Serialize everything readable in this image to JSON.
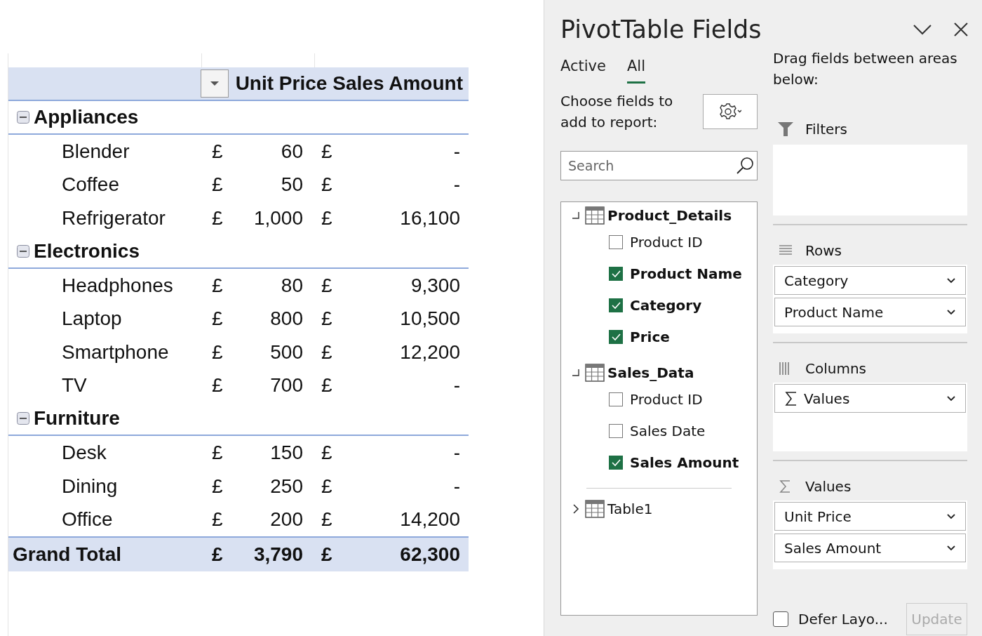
{
  "pivot": {
    "header": {
      "columns": [
        "Unit Price",
        "Sales Amount"
      ]
    },
    "groups": [
      {
        "name": "Appliances",
        "expanded": true,
        "items": [
          {
            "name": "Blender",
            "unit_currency": "£",
            "unit_price": "60",
            "sales_currency": "£",
            "sales_amount": "-"
          },
          {
            "name": "Coffee",
            "unit_currency": "£",
            "unit_price": "50",
            "sales_currency": "£",
            "sales_amount": "-"
          },
          {
            "name": "Refrigerator",
            "unit_currency": "£",
            "unit_price": "1,000",
            "sales_currency": "£",
            "sales_amount": "16,100"
          }
        ]
      },
      {
        "name": "Electronics",
        "expanded": true,
        "items": [
          {
            "name": "Headphones",
            "unit_currency": "£",
            "unit_price": "80",
            "sales_currency": "£",
            "sales_amount": "9,300"
          },
          {
            "name": "Laptop",
            "unit_currency": "£",
            "unit_price": "800",
            "sales_currency": "£",
            "sales_amount": "10,500"
          },
          {
            "name": "Smartphone",
            "unit_currency": "£",
            "unit_price": "500",
            "sales_currency": "£",
            "sales_amount": "12,200"
          },
          {
            "name": "TV",
            "unit_currency": "£",
            "unit_price": "700",
            "sales_currency": "£",
            "sales_amount": "-"
          }
        ]
      },
      {
        "name": "Furniture",
        "expanded": true,
        "items": [
          {
            "name": "Desk",
            "unit_currency": "£",
            "unit_price": "150",
            "sales_currency": "£",
            "sales_amount": "-"
          },
          {
            "name": "Dining",
            "unit_currency": "£",
            "unit_price": "250",
            "sales_currency": "£",
            "sales_amount": "-"
          },
          {
            "name": "Office",
            "unit_currency": "£",
            "unit_price": "200",
            "sales_currency": "£",
            "sales_amount": "14,200"
          }
        ]
      }
    ],
    "grand_total": {
      "label": "Grand Total",
      "unit_currency": "£",
      "unit_price": "3,790",
      "sales_currency": "£",
      "sales_amount": "62,300"
    }
  },
  "pane": {
    "title": "PivotTable Fields",
    "tabs": [
      {
        "label": "Active",
        "selected": false
      },
      {
        "label": "All",
        "selected": true
      }
    ],
    "choose_label": "Choose fields to add to report:",
    "search": {
      "placeholder": "Search"
    },
    "tables": [
      {
        "name": "Product_Details",
        "expanded": true,
        "fields": [
          {
            "name": "Product ID",
            "checked": false
          },
          {
            "name": "Product Name",
            "checked": true
          },
          {
            "name": "Category",
            "checked": true
          },
          {
            "name": "Price",
            "checked": true
          }
        ]
      },
      {
        "name": "Sales_Data",
        "expanded": true,
        "fields": [
          {
            "name": "Product ID",
            "checked": false
          },
          {
            "name": "Sales Date",
            "checked": false
          },
          {
            "name": "Sales Amount",
            "checked": true
          }
        ]
      },
      {
        "name": "Table1",
        "expanded": false
      }
    ],
    "areas_hint": "Drag fields between areas below:",
    "areas": [
      {
        "kind": "filters",
        "label": "Filters"
      },
      {
        "kind": "rows",
        "label": "Rows",
        "items": [
          {
            "label": "Category",
            "kind": "field"
          },
          {
            "label": "Product Name",
            "kind": "field"
          }
        ]
      },
      {
        "kind": "columns",
        "label": "Columns",
        "items": [
          {
            "label": "Values",
            "kind": "sigma"
          }
        ]
      },
      {
        "kind": "values",
        "label": "Values",
        "items": [
          {
            "label": "Unit Price",
            "kind": "field"
          },
          {
            "label": "Sales Amount",
            "kind": "field"
          }
        ]
      }
    ],
    "defer": {
      "label": "Defer Layo...",
      "checked": false
    },
    "update": {
      "label": "Update",
      "disabled": true
    }
  }
}
